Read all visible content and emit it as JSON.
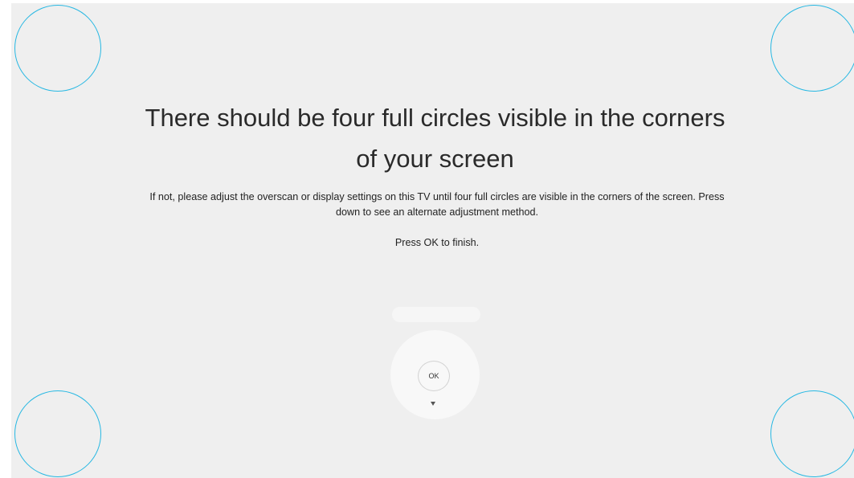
{
  "instructions": {
    "title": "There should be four full circles visible in the corners of your screen",
    "description": "If not, please adjust the overscan or display settings on this TV until four full circles are visible in the corners of the screen. Press down to see an alternate adjustment method.",
    "finish": "Press OK to finish."
  },
  "remote": {
    "ok_label": "OK",
    "down_icon": "triangle-down"
  },
  "colors": {
    "circle_outline": "#27b8e3",
    "background": "#efefef",
    "text": "#2a2a2a"
  }
}
